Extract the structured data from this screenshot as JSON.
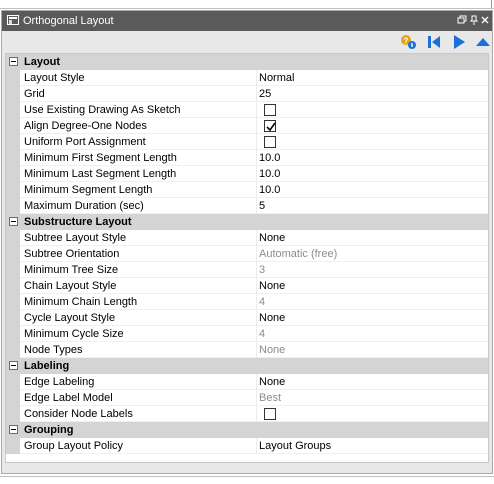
{
  "window": {
    "title": "Orthogonal Layout",
    "title_buttons": [
      "restore-icon",
      "pin-icon",
      "close-icon"
    ]
  },
  "toolbar": {
    "icons": [
      "settings-info-icon",
      "reset-to-start-icon",
      "run-layout-icon",
      "collapse-icon"
    ],
    "colors": {
      "blue": "#1e6fd9",
      "gold": "#e2a614"
    }
  },
  "sections": [
    {
      "label": "Layout",
      "expanded": true,
      "properties": [
        {
          "name": "Layout Style",
          "value": "Normal",
          "kind": "text",
          "enabled": true
        },
        {
          "name": "Grid",
          "value": "25",
          "kind": "text",
          "enabled": true
        },
        {
          "name": "Use Existing Drawing As Sketch",
          "value": "",
          "kind": "checkbox",
          "checked": false,
          "enabled": true
        },
        {
          "name": "Align Degree-One Nodes",
          "value": "",
          "kind": "checkbox",
          "checked": true,
          "enabled": true
        },
        {
          "name": "Uniform Port Assignment",
          "value": "",
          "kind": "checkbox",
          "checked": false,
          "enabled": true
        },
        {
          "name": "Minimum First Segment Length",
          "value": "10.0",
          "kind": "text",
          "enabled": true
        },
        {
          "name": "Minimum Last Segment Length",
          "value": "10.0",
          "kind": "text",
          "enabled": true
        },
        {
          "name": "Minimum Segment Length",
          "value": "10.0",
          "kind": "text",
          "enabled": true
        },
        {
          "name": "Maximum Duration (sec)",
          "value": "5",
          "kind": "text",
          "enabled": true
        }
      ]
    },
    {
      "label": "Substructure Layout",
      "expanded": true,
      "properties": [
        {
          "name": "Subtree Layout Style",
          "value": "None",
          "kind": "text",
          "enabled": true
        },
        {
          "name": "Subtree Orientation",
          "value": "Automatic (free)",
          "kind": "text",
          "enabled": false
        },
        {
          "name": "Minimum Tree Size",
          "value": "3",
          "kind": "text",
          "enabled": false
        },
        {
          "name": "Chain Layout Style",
          "value": "None",
          "kind": "text",
          "enabled": true
        },
        {
          "name": "Minimum Chain Length",
          "value": "4",
          "kind": "text",
          "enabled": false
        },
        {
          "name": "Cycle Layout Style",
          "value": "None",
          "kind": "text",
          "enabled": true
        },
        {
          "name": "Minimum Cycle Size",
          "value": "4",
          "kind": "text",
          "enabled": false
        },
        {
          "name": "Node Types",
          "value": "None",
          "kind": "text",
          "enabled": false
        }
      ]
    },
    {
      "label": "Labeling",
      "expanded": true,
      "properties": [
        {
          "name": "Edge Labeling",
          "value": "None",
          "kind": "text",
          "enabled": true
        },
        {
          "name": "Edge Label Model",
          "value": "Best",
          "kind": "text",
          "enabled": false
        },
        {
          "name": "Consider Node Labels",
          "value": "",
          "kind": "checkbox",
          "checked": false,
          "enabled": true
        }
      ]
    },
    {
      "label": "Grouping",
      "expanded": true,
      "properties": [
        {
          "name": "Group Layout Policy",
          "value": "Layout Groups",
          "kind": "text",
          "enabled": true
        }
      ]
    }
  ]
}
